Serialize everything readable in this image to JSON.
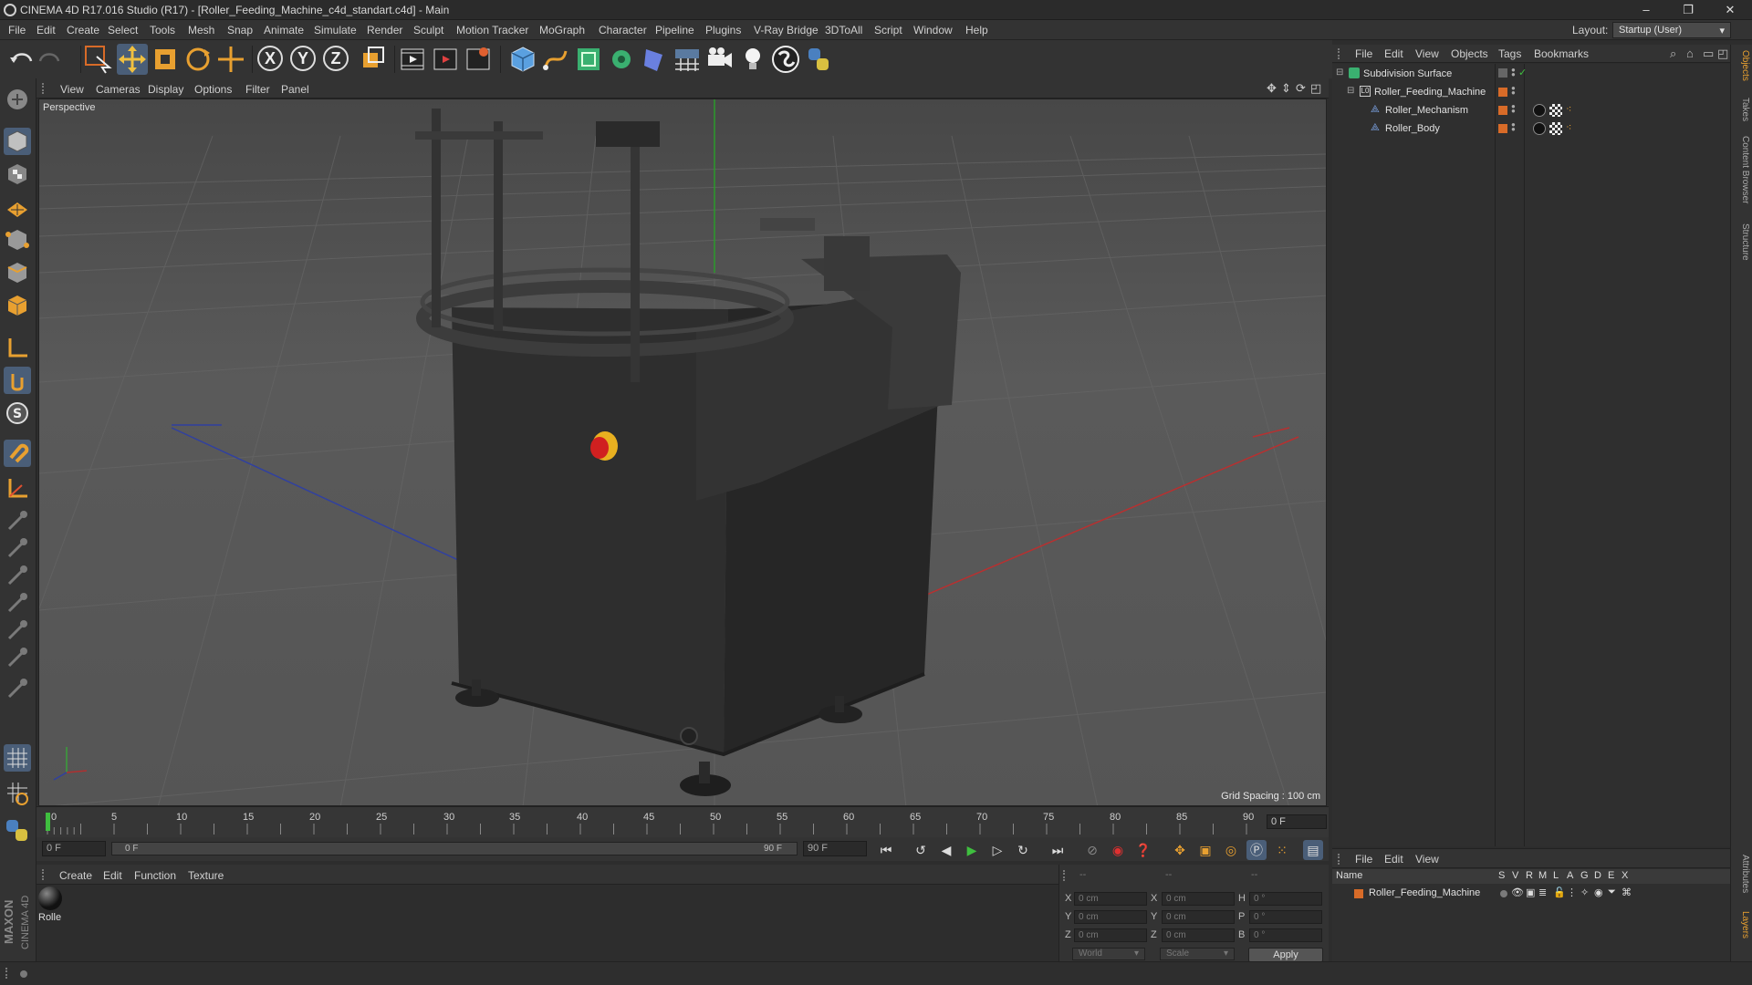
{
  "window": {
    "title": "CINEMA 4D R17.016 Studio (R17) - [Roller_Feeding_Machine_c4d_standart.c4d] - Main",
    "controls": [
      "–",
      "❐",
      "✕"
    ]
  },
  "menubar": {
    "items": [
      "File",
      "Edit",
      "Create",
      "Select",
      "Tools",
      "Mesh",
      "Snap",
      "Animate",
      "Simulate",
      "Render",
      "Sculpt",
      "Motion Tracker",
      "MoGraph",
      "Character",
      "Pipeline",
      "Plugins",
      "V-Ray Bridge",
      "3DToAll",
      "Script",
      "Window",
      "Help"
    ],
    "layout_label": "Layout:",
    "layout_value": "Startup (User)"
  },
  "toolbar": {
    "axis_x": "X",
    "axis_y": "Y",
    "axis_z": "Z"
  },
  "viewport": {
    "menu": [
      "View",
      "Cameras",
      "Display",
      "Options",
      "Filter",
      "Panel"
    ],
    "label": "Perspective",
    "grid_spacing": "Grid Spacing : 100 cm"
  },
  "timeline": {
    "ticks": [
      "0",
      "5",
      "10",
      "15",
      "20",
      "25",
      "30",
      "35",
      "40",
      "45",
      "50",
      "55",
      "60",
      "65",
      "70",
      "75",
      "80",
      "85",
      "90"
    ],
    "frame_display": "0 F",
    "start_field": "0 F",
    "range_start": "0 F",
    "range_end": "90 F",
    "end_field": "90 F"
  },
  "materials": {
    "menu": [
      "Create",
      "Edit",
      "Function",
      "Texture"
    ],
    "items": [
      {
        "name": "Rolle"
      }
    ]
  },
  "coordinates": {
    "header_a": "--",
    "header_b": "--",
    "header_c": "--",
    "rows": [
      {
        "l1": "X",
        "v1": "0 cm",
        "l2": "X",
        "v2": "0 cm",
        "l3": "H",
        "v3": "0 °"
      },
      {
        "l1": "Y",
        "v1": "0 cm",
        "l2": "Y",
        "v2": "0 cm",
        "l3": "P",
        "v3": "0 °"
      },
      {
        "l1": "Z",
        "v1": "0 cm",
        "l2": "Z",
        "v2": "0 cm",
        "l3": "B",
        "v3": "0 °"
      }
    ],
    "mode": "World",
    "transform": "Scale",
    "apply": "Apply"
  },
  "objects": {
    "menu": [
      "File",
      "Edit",
      "View",
      "Objects",
      "Tags",
      "Bookmarks"
    ],
    "tree": [
      {
        "name": "Subdivision Surface",
        "indent": 0
      },
      {
        "name": "Roller_Feeding_Machine",
        "indent": 1
      },
      {
        "name": "Roller_Mechanism",
        "indent": 2
      },
      {
        "name": "Roller_Body",
        "indent": 2
      }
    ]
  },
  "layers": {
    "menu": [
      "File",
      "Edit",
      "View"
    ],
    "columns": [
      "Name",
      "S",
      "V",
      "R",
      "M",
      "L",
      "A",
      "G",
      "D",
      "E",
      "X"
    ],
    "rows": [
      {
        "name": "Roller_Feeding_Machine"
      }
    ]
  },
  "sidebar_tabs": [
    "Objects",
    "Takes",
    "Content Browser",
    "Structure",
    "Attributes",
    "Layers"
  ],
  "branding": {
    "line1": "MAXON",
    "line2": "CINEMA 4D"
  },
  "colors": {
    "accent_orange": "#d86b28",
    "play_green": "#3fbf3f",
    "x_axis_red": "#c03030",
    "z_axis_blue": "#3040a0"
  }
}
